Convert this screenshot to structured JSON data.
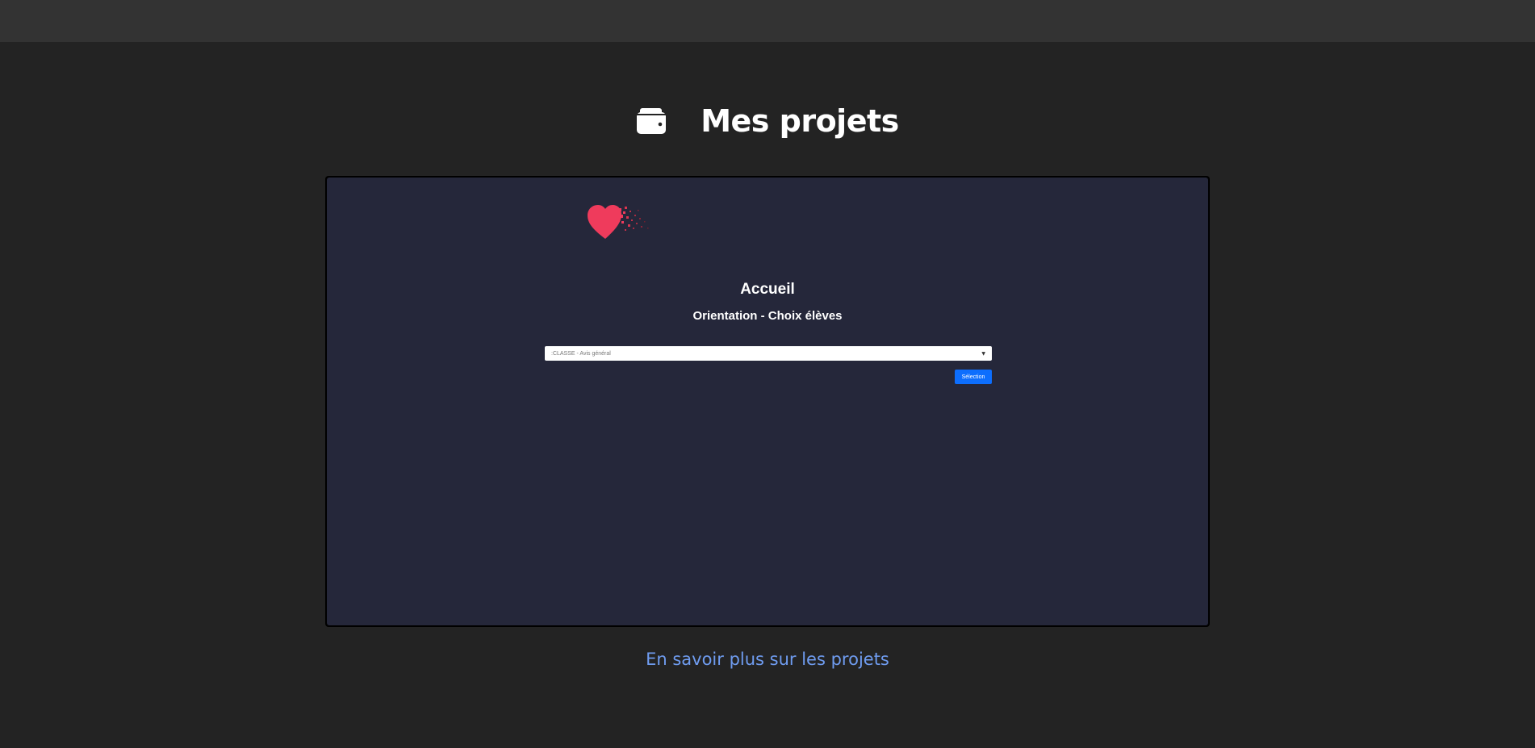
{
  "header": {
    "title": "Mes projets",
    "icon": "wallet-icon"
  },
  "preview": {
    "logo": "heart-logo",
    "title": "Accueil",
    "subtitle": "Orientation - Choix élèves",
    "select": {
      "value": ":CLASSE - Avis général"
    },
    "button_label": "Sélection"
  },
  "footer": {
    "link_text": "En savoir plus sur les projets"
  },
  "colors": {
    "background": "#232323",
    "topbar": "#333333",
    "preview_bg": "#25273a",
    "heart": "#ef3b5c",
    "button": "#0d6efd",
    "link": "#6f9cf0"
  }
}
